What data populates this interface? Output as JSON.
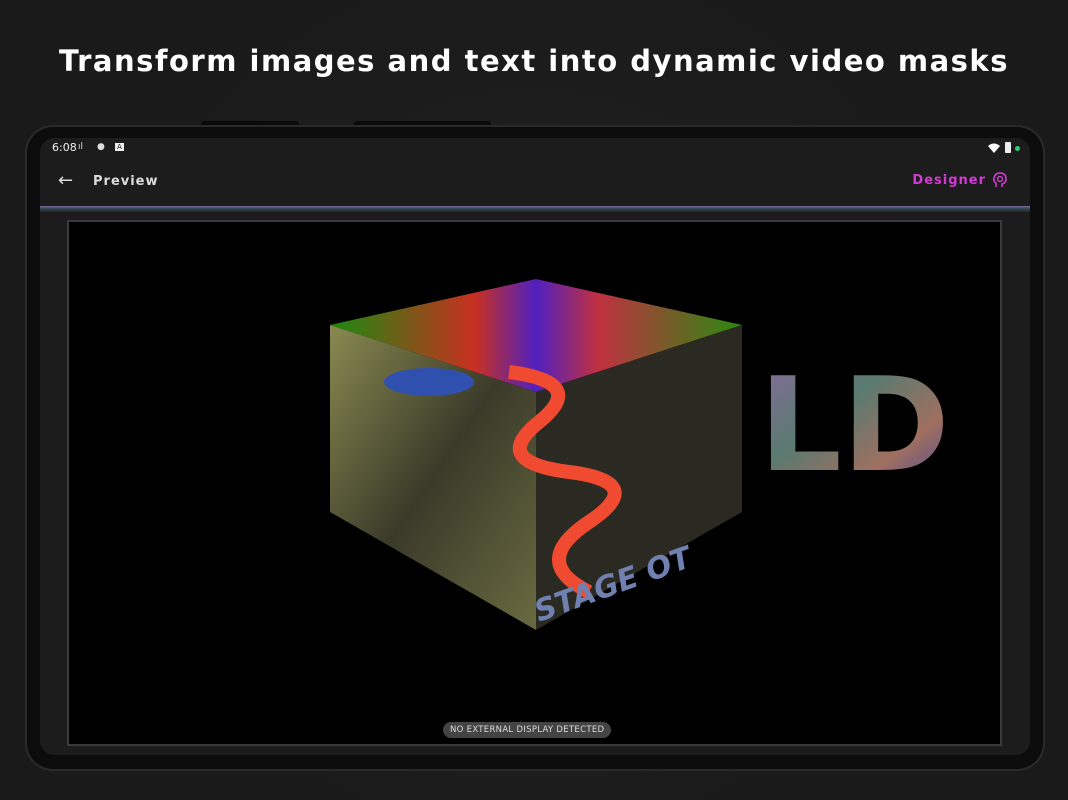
{
  "headline": "Transform images and text into dynamic video masks",
  "status_bar": {
    "time": "6:08",
    "icons": [
      "signal-bars-icon",
      "notification-icon",
      "a-icon"
    ],
    "right_icons": [
      "wifi-icon",
      "battery-icon",
      "status-dot"
    ],
    "dot_color": "#2ecc71"
  },
  "app_bar": {
    "title": "Preview",
    "back_icon": "arrow-left-icon",
    "designer_label": "Designer",
    "designer_icon": "head-swirl-icon",
    "accent": "#d23ad6"
  },
  "preview": {
    "cube_text": "STAGE OT",
    "mask_text": "LD",
    "notice": "NO EXTERNAL DISPLAY DETECTED"
  }
}
